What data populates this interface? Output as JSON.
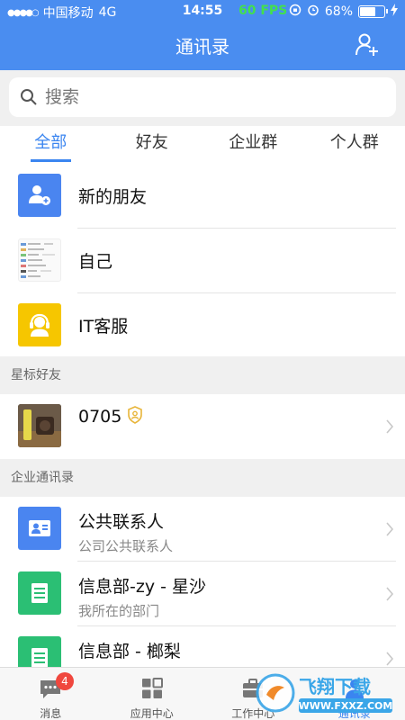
{
  "status_bar": {
    "carrier": "中国移动",
    "network": "4G",
    "time": "14:55",
    "fps": "60 FPS",
    "battery": "68%",
    "battery_level": 0.68
  },
  "header": {
    "title": "通讯录",
    "add_friend_icon": "add-user-icon"
  },
  "search": {
    "placeholder": "搜索"
  },
  "tabs": [
    {
      "label": "全部",
      "active": true
    },
    {
      "label": "好友",
      "active": false
    },
    {
      "label": "企业群",
      "active": false
    },
    {
      "label": "个人群",
      "active": false
    }
  ],
  "top_items": [
    {
      "label": "新的朋友",
      "icon": "new-friend-icon",
      "color": "#4a85f0"
    },
    {
      "label": "自己",
      "icon": "self-avatar-thumbnail"
    },
    {
      "label": "IT客服",
      "icon": "support-headset-icon",
      "color": "#f6c600"
    }
  ],
  "starred": {
    "header": "星标好友",
    "items": [
      {
        "label": "0705",
        "badge_icon": "verified-shield-icon"
      }
    ]
  },
  "enterprise": {
    "header": "企业通讯录",
    "items": [
      {
        "title": "公共联系人",
        "subtitle": "公司公共联系人",
        "icon": "contact-card-icon",
        "color": "#4a85f0"
      },
      {
        "title": "信息部-zy - 星沙",
        "subtitle": "我所在的部门",
        "icon": "department-list-icon",
        "color": "#2bbf74"
      },
      {
        "title": "信息部 - 榔梨",
        "subtitle": "",
        "icon": "department-list-icon",
        "color": "#2bbf74"
      }
    ]
  },
  "tab_bar": [
    {
      "label": "消息",
      "icon": "message-icon",
      "badge": "4"
    },
    {
      "label": "应用中心",
      "icon": "app-grid-icon"
    },
    {
      "label": "工作中心",
      "icon": "briefcase-icon"
    },
    {
      "label": "通讯录",
      "icon": "contacts-icon",
      "active": true
    }
  ],
  "watermark": {
    "text": "飞翔下载",
    "url": "WWW.FXXZ.COM"
  }
}
